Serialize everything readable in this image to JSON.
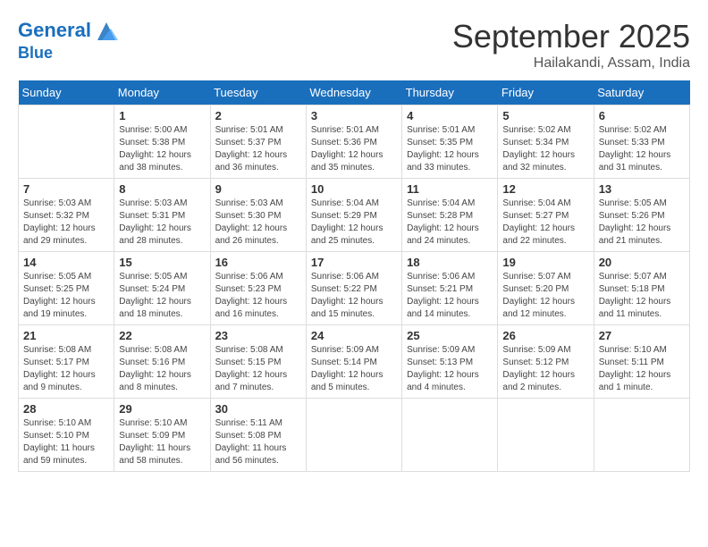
{
  "logo": {
    "line1": "General",
    "line2": "Blue"
  },
  "header": {
    "month": "September 2025",
    "location": "Hailakandi, Assam, India"
  },
  "days_of_week": [
    "Sunday",
    "Monday",
    "Tuesday",
    "Wednesday",
    "Thursday",
    "Friday",
    "Saturday"
  ],
  "weeks": [
    [
      {
        "day": "",
        "info": ""
      },
      {
        "day": "1",
        "info": "Sunrise: 5:00 AM\nSunset: 5:38 PM\nDaylight: 12 hours\nand 38 minutes."
      },
      {
        "day": "2",
        "info": "Sunrise: 5:01 AM\nSunset: 5:37 PM\nDaylight: 12 hours\nand 36 minutes."
      },
      {
        "day": "3",
        "info": "Sunrise: 5:01 AM\nSunset: 5:36 PM\nDaylight: 12 hours\nand 35 minutes."
      },
      {
        "day": "4",
        "info": "Sunrise: 5:01 AM\nSunset: 5:35 PM\nDaylight: 12 hours\nand 33 minutes."
      },
      {
        "day": "5",
        "info": "Sunrise: 5:02 AM\nSunset: 5:34 PM\nDaylight: 12 hours\nand 32 minutes."
      },
      {
        "day": "6",
        "info": "Sunrise: 5:02 AM\nSunset: 5:33 PM\nDaylight: 12 hours\nand 31 minutes."
      }
    ],
    [
      {
        "day": "7",
        "info": "Sunrise: 5:03 AM\nSunset: 5:32 PM\nDaylight: 12 hours\nand 29 minutes."
      },
      {
        "day": "8",
        "info": "Sunrise: 5:03 AM\nSunset: 5:31 PM\nDaylight: 12 hours\nand 28 minutes."
      },
      {
        "day": "9",
        "info": "Sunrise: 5:03 AM\nSunset: 5:30 PM\nDaylight: 12 hours\nand 26 minutes."
      },
      {
        "day": "10",
        "info": "Sunrise: 5:04 AM\nSunset: 5:29 PM\nDaylight: 12 hours\nand 25 minutes."
      },
      {
        "day": "11",
        "info": "Sunrise: 5:04 AM\nSunset: 5:28 PM\nDaylight: 12 hours\nand 24 minutes."
      },
      {
        "day": "12",
        "info": "Sunrise: 5:04 AM\nSunset: 5:27 PM\nDaylight: 12 hours\nand 22 minutes."
      },
      {
        "day": "13",
        "info": "Sunrise: 5:05 AM\nSunset: 5:26 PM\nDaylight: 12 hours\nand 21 minutes."
      }
    ],
    [
      {
        "day": "14",
        "info": "Sunrise: 5:05 AM\nSunset: 5:25 PM\nDaylight: 12 hours\nand 19 minutes."
      },
      {
        "day": "15",
        "info": "Sunrise: 5:05 AM\nSunset: 5:24 PM\nDaylight: 12 hours\nand 18 minutes."
      },
      {
        "day": "16",
        "info": "Sunrise: 5:06 AM\nSunset: 5:23 PM\nDaylight: 12 hours\nand 16 minutes."
      },
      {
        "day": "17",
        "info": "Sunrise: 5:06 AM\nSunset: 5:22 PM\nDaylight: 12 hours\nand 15 minutes."
      },
      {
        "day": "18",
        "info": "Sunrise: 5:06 AM\nSunset: 5:21 PM\nDaylight: 12 hours\nand 14 minutes."
      },
      {
        "day": "19",
        "info": "Sunrise: 5:07 AM\nSunset: 5:20 PM\nDaylight: 12 hours\nand 12 minutes."
      },
      {
        "day": "20",
        "info": "Sunrise: 5:07 AM\nSunset: 5:18 PM\nDaylight: 12 hours\nand 11 minutes."
      }
    ],
    [
      {
        "day": "21",
        "info": "Sunrise: 5:08 AM\nSunset: 5:17 PM\nDaylight: 12 hours\nand 9 minutes."
      },
      {
        "day": "22",
        "info": "Sunrise: 5:08 AM\nSunset: 5:16 PM\nDaylight: 12 hours\nand 8 minutes."
      },
      {
        "day": "23",
        "info": "Sunrise: 5:08 AM\nSunset: 5:15 PM\nDaylight: 12 hours\nand 7 minutes."
      },
      {
        "day": "24",
        "info": "Sunrise: 5:09 AM\nSunset: 5:14 PM\nDaylight: 12 hours\nand 5 minutes."
      },
      {
        "day": "25",
        "info": "Sunrise: 5:09 AM\nSunset: 5:13 PM\nDaylight: 12 hours\nand 4 minutes."
      },
      {
        "day": "26",
        "info": "Sunrise: 5:09 AM\nSunset: 5:12 PM\nDaylight: 12 hours\nand 2 minutes."
      },
      {
        "day": "27",
        "info": "Sunrise: 5:10 AM\nSunset: 5:11 PM\nDaylight: 12 hours\nand 1 minute."
      }
    ],
    [
      {
        "day": "28",
        "info": "Sunrise: 5:10 AM\nSunset: 5:10 PM\nDaylight: 11 hours\nand 59 minutes."
      },
      {
        "day": "29",
        "info": "Sunrise: 5:10 AM\nSunset: 5:09 PM\nDaylight: 11 hours\nand 58 minutes."
      },
      {
        "day": "30",
        "info": "Sunrise: 5:11 AM\nSunset: 5:08 PM\nDaylight: 11 hours\nand 56 minutes."
      },
      {
        "day": "",
        "info": ""
      },
      {
        "day": "",
        "info": ""
      },
      {
        "day": "",
        "info": ""
      },
      {
        "day": "",
        "info": ""
      }
    ]
  ]
}
